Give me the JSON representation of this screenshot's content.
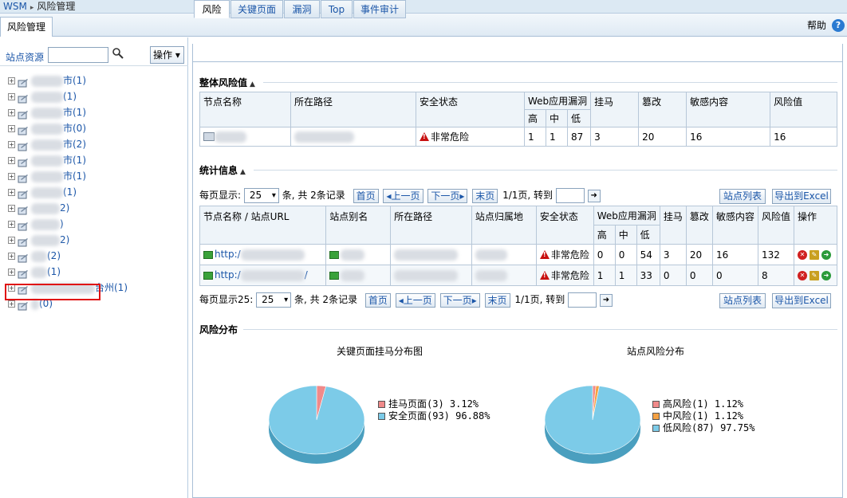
{
  "breadcrumb": {
    "root": "WSM",
    "current": "风险管理"
  },
  "main_tab": "风险管理",
  "help": "帮助",
  "sidebar": {
    "site_label": "站点资源",
    "operate_button": "操作",
    "tree": [
      {
        "label": "市(1)"
      },
      {
        "label": "(1)"
      },
      {
        "label": "市(1)"
      },
      {
        "label": "市(0)"
      },
      {
        "label": "市(2)"
      },
      {
        "label": "市(1)"
      },
      {
        "label": "市(1)"
      },
      {
        "label": "(1)"
      },
      {
        "label": "2)"
      },
      {
        "label": ")"
      },
      {
        "label": "2)"
      },
      {
        "label": "(2)"
      },
      {
        "label": "(1)"
      },
      {
        "label": "台州(1)"
      },
      {
        "label": "(0)"
      }
    ]
  },
  "content_tabs": [
    "风险",
    "关键页面",
    "漏洞",
    "Top",
    "事件审计"
  ],
  "overall": {
    "title": "整体风险值",
    "headers": {
      "name": "节点名称",
      "path": "所在路径",
      "status": "安全状态",
      "vuln": "Web应用漏洞",
      "high": "高",
      "mid": "中",
      "low": "低",
      "trojan": "挂马",
      "tamper": "篡改",
      "sensitive": "敏感内容",
      "risk": "风险值"
    },
    "row": {
      "status": "非常危险",
      "high": "1",
      "mid": "1",
      "low": "87",
      "trojan": "3",
      "tamper": "20",
      "sensitive": "16",
      "risk": "16"
    }
  },
  "stats": {
    "title": "统计信息",
    "pager_top": {
      "per_page": "每页显示:",
      "size": "25",
      "summary": "条, 共 2条记录",
      "first": "首页",
      "prev": "上一页",
      "next": "下一页",
      "last": "末页",
      "pages": "1/1页, 转到"
    },
    "pager_bottom": {
      "per_page": "每页显示25:",
      "size": "25",
      "summary": "条, 共 2条记录",
      "first": "首页",
      "prev": "上一页",
      "next": "下一页",
      "last": "末页",
      "pages": "1/1页, 转到"
    },
    "site_list": "站点列表",
    "export": "导出到Excel",
    "headers": {
      "name_url": "节点名称 / 站点URL",
      "alias": "站点别名",
      "path": "所在路径",
      "location": "站点归属地",
      "status": "安全状态",
      "vuln": "Web应用漏洞",
      "high": "高",
      "mid": "中",
      "low": "低",
      "trojan": "挂马",
      "tamper": "篡改",
      "sensitive": "敏感内容",
      "risk": "风险值",
      "ops": "操作"
    },
    "rows": [
      {
        "url": "http:/",
        "status": "非常危险",
        "high": "0",
        "mid": "0",
        "low": "54",
        "trojan": "3",
        "tamper": "20",
        "sensitive": "16",
        "risk": "132"
      },
      {
        "url": "http:/",
        "url_tail": "/",
        "status": "非常危险",
        "high": "1",
        "mid": "1",
        "low": "33",
        "trojan": "0",
        "tamper": "0",
        "sensitive": "0",
        "risk": "8"
      }
    ]
  },
  "distribution": {
    "title": "风险分布",
    "chart1": {
      "title": "关键页面挂马分布图",
      "legend": [
        {
          "label": "挂马页面(3)  3.12%",
          "color": "#f08a8a"
        },
        {
          "label": "安全页面(93)  96.88%",
          "color": "#7ccbe8"
        }
      ]
    },
    "chart2": {
      "title": "站点风险分布",
      "legend": [
        {
          "label": "高风险(1)  1.12%",
          "color": "#f08a8a"
        },
        {
          "label": "中风险(1)  1.12%",
          "color": "#f5a142"
        },
        {
          "label": "低风险(87)  97.75%",
          "color": "#7ccbe8"
        }
      ]
    }
  },
  "chart_data": [
    {
      "type": "pie",
      "title": "关键页面挂马分布图",
      "categories": [
        "挂马页面",
        "安全页面"
      ],
      "values": [
        3,
        93
      ],
      "percents": [
        3.12,
        96.88
      ],
      "colors": [
        "#f08a8a",
        "#7ccbe8"
      ]
    },
    {
      "type": "pie",
      "title": "站点风险分布",
      "categories": [
        "高风险",
        "中风险",
        "低风险"
      ],
      "values": [
        1,
        1,
        87
      ],
      "percents": [
        1.12,
        1.12,
        97.75
      ],
      "colors": [
        "#f08a8a",
        "#f5a142",
        "#7ccbe8"
      ]
    }
  ]
}
